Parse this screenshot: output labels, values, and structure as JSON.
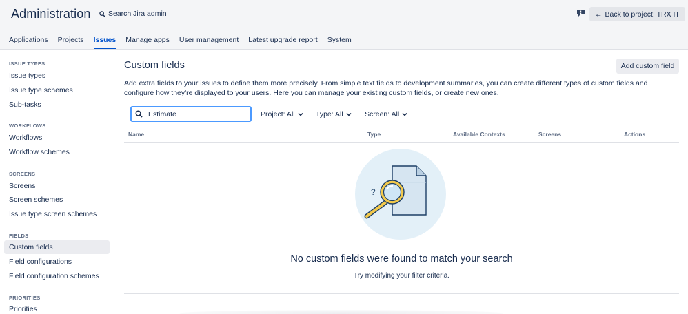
{
  "header": {
    "title": "Administration",
    "search_label": "Search Jira admin",
    "back_label": "Back to project: TRX IT",
    "tabs": [
      {
        "label": "Applications"
      },
      {
        "label": "Projects"
      },
      {
        "label": "Issues"
      },
      {
        "label": "Manage apps"
      },
      {
        "label": "User management"
      },
      {
        "label": "Latest upgrade report"
      },
      {
        "label": "System"
      }
    ]
  },
  "sidebar": {
    "sections": [
      {
        "title": "ISSUE TYPES",
        "items": [
          "Issue types",
          "Issue type schemes",
          "Sub-tasks"
        ]
      },
      {
        "title": "WORKFLOWS",
        "items": [
          "Workflows",
          "Workflow schemes"
        ]
      },
      {
        "title": "SCREENS",
        "items": [
          "Screens",
          "Screen schemes",
          "Issue type screen schemes"
        ]
      },
      {
        "title": "FIELDS",
        "items": [
          "Custom fields",
          "Field configurations",
          "Field configuration schemes"
        ]
      },
      {
        "title": "PRIORITIES",
        "items": [
          "Priorities"
        ]
      }
    ]
  },
  "main": {
    "title": "Custom fields",
    "add_button": "Add custom field",
    "description": "Add extra fields to your issues to define them more precisely. From simple text fields to development summaries, you can create different types of custom fields and configure how they're displayed to your users. Here you can manage your existing custom fields, or create new ones.",
    "search_value": "Estimate",
    "filters": {
      "project": "Project: All",
      "type": "Type: All",
      "screen": "Screen: All"
    },
    "columns": {
      "name": "Name",
      "type": "Type",
      "contexts": "Available Contexts",
      "screens": "Screens",
      "actions": "Actions"
    },
    "empty_title": "No custom fields were found to match your search",
    "empty_subtitle": "Try modifying your filter criteria."
  },
  "colors": {
    "accent": "#0052cc",
    "focus": "#4c9aff",
    "text": "#172b4d"
  }
}
